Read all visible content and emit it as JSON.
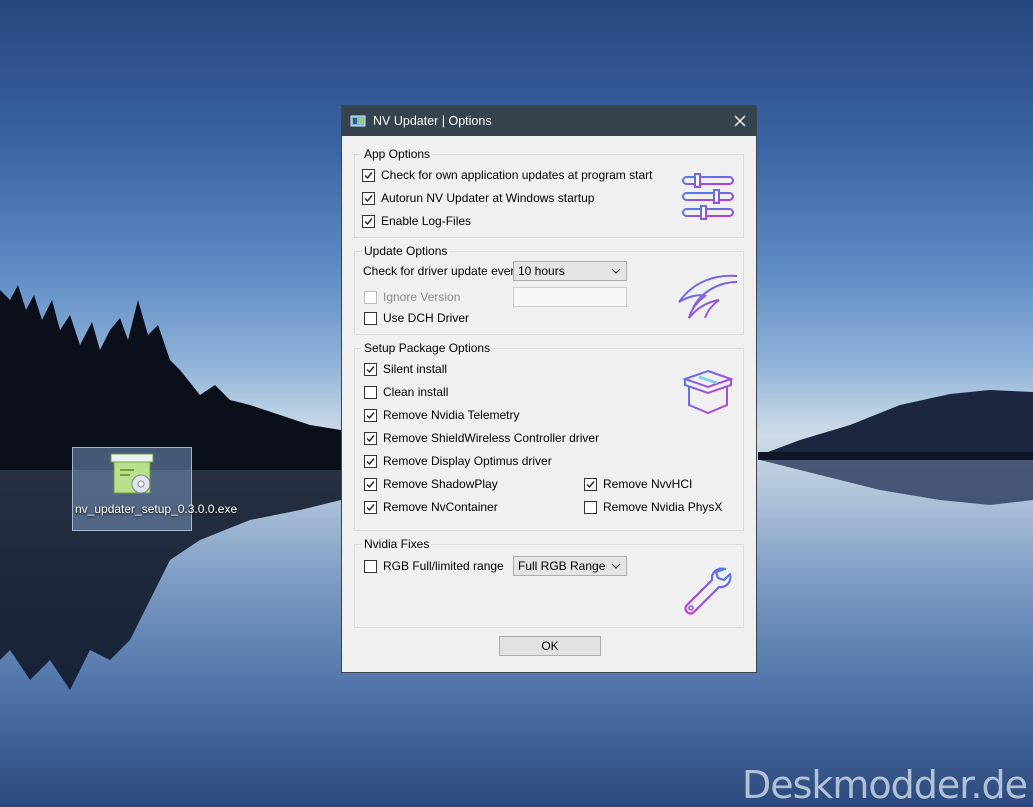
{
  "desktop": {
    "icon_label": "nv_updater_setup_0.3.0.0.exe",
    "watermark": "Deskmodder.de"
  },
  "dialog": {
    "title": "NV Updater  | Options",
    "app_options": {
      "title": "App Options",
      "items": [
        {
          "label": "Check for own application updates at program start",
          "checked": true
        },
        {
          "label": "Autorun NV Updater at Windows startup",
          "checked": true
        },
        {
          "label": "Enable Log-Files",
          "checked": true
        }
      ]
    },
    "update_options": {
      "title": "Update Options",
      "check_label": "Check for driver update every",
      "interval_value": "10 hours",
      "ignore_version_label": "Ignore Version",
      "ignore_version_value": "",
      "use_dch_label": "Use DCH Driver"
    },
    "setup_package": {
      "title": "Setup Package Options",
      "items": [
        {
          "label": "Silent install",
          "checked": true
        },
        {
          "label": "Clean install",
          "checked": false
        },
        {
          "label": "Remove Nvidia Telemetry",
          "checked": true
        },
        {
          "label": "Remove ShieldWireless Controller driver",
          "checked": true
        },
        {
          "label": "Remove Display Optimus driver",
          "checked": true
        },
        {
          "label": "Remove ShadowPlay",
          "checked": true
        },
        {
          "label": "Remove NvContainer",
          "checked": true
        },
        {
          "label": "Remove NvvHCI",
          "checked": true
        },
        {
          "label": "Remove Nvidia PhysX",
          "checked": false
        }
      ]
    },
    "nvidia_fixes": {
      "title": "Nvidia Fixes",
      "rgb_label": "RGB Full/limited range",
      "rgb_value": "Full RGB Range"
    },
    "ok_label": "OK"
  }
}
